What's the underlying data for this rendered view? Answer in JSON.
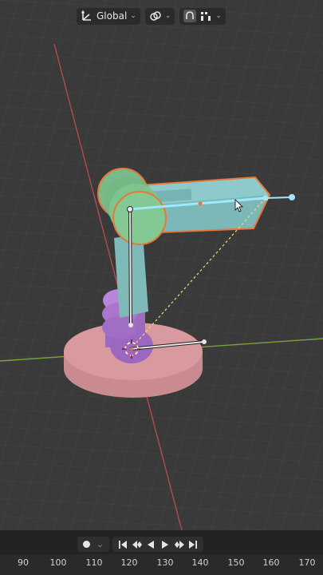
{
  "header": {
    "transform_orientation": "Global",
    "icons": [
      "transform-orientation-icon",
      "snap-link-icon",
      "proportional-edit-icon",
      "snap-increment-icon"
    ]
  },
  "viewport": {
    "icons": [
      "3d-cursor-icon"
    ],
    "colors": {
      "background": "#3a3a3a",
      "grid": "#444444",
      "x_axis": "#b44a4f",
      "y_axis": "#7aa23a",
      "selection_outline": "#e8773a",
      "active_bone": "#9fe8ff",
      "base_pink": "#d89a9f",
      "joint_purple": "#b07ad6",
      "arm_teal": "#80bcbc",
      "joint_green": "#7ec48d"
    }
  },
  "timeline": {
    "frame_ticks": [
      "90",
      "100",
      "110",
      "120",
      "130",
      "140",
      "150",
      "160",
      "170"
    ],
    "playback_icons": [
      "jump-start-icon",
      "prev-keyframe-icon",
      "play-reverse-icon",
      "play-icon",
      "next-keyframe-icon",
      "jump-end-icon"
    ]
  }
}
